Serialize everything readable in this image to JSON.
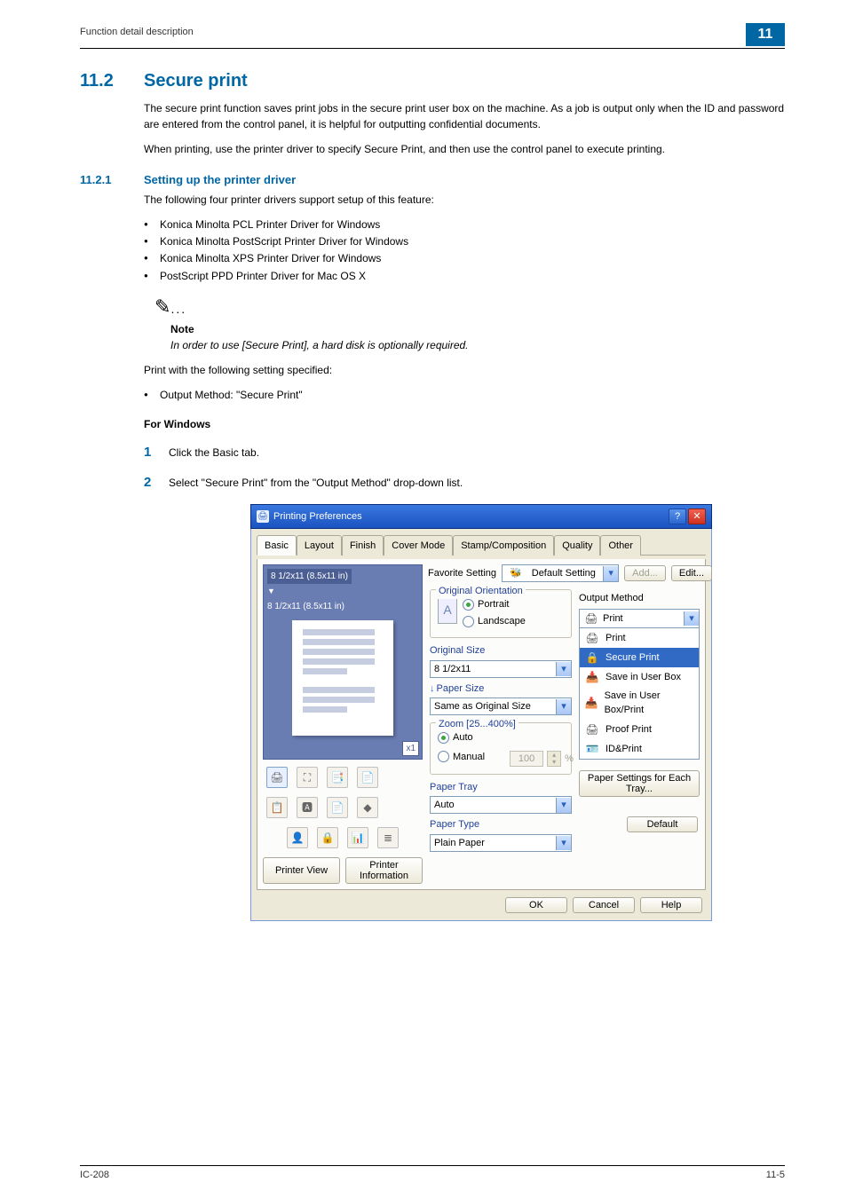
{
  "header": {
    "left": "Function detail description",
    "badge": "11"
  },
  "section": {
    "num": "11.2",
    "title": "Secure print",
    "para1": "The secure print function saves print jobs in the secure print user box on the machine. As a job is output only when the ID and password are entered from the control panel, it is helpful for outputting confidential documents.",
    "para2": "When printing, use the printer driver to specify Secure Print, and then use the control panel to execute printing."
  },
  "subsection": {
    "num": "11.2.1",
    "title": "Setting up the printer driver",
    "intro": "The following four printer drivers support setup of this feature:",
    "drivers": [
      "Konica Minolta PCL Printer Driver for Windows",
      "Konica Minolta PostScript Printer Driver for Windows",
      "Konica Minolta XPS Printer Driver for Windows",
      "PostScript PPD Printer Driver for Mac OS X"
    ],
    "note_label": "Note",
    "note_text": "In order to use [Secure Print], a hard disk is optionally required.",
    "print_with": "Print with the following setting specified:",
    "setting_item": "Output Method: \"Secure Print\"",
    "for_windows": "For Windows",
    "step1": "Click the Basic tab.",
    "step2": "Select \"Secure Print\" from the \"Output Method\" drop-down list."
  },
  "dialog": {
    "title": "Printing Preferences",
    "tabs": [
      "Basic",
      "Layout",
      "Finish",
      "Cover Mode",
      "Stamp/Composition",
      "Quality",
      "Other"
    ],
    "preview": {
      "size1": "8 1/2x11 (8.5x11 in)",
      "size2": "8 1/2x11 (8.5x11 in)",
      "badge": "x1"
    },
    "printer_view": "Printer View",
    "printer_info": "Printer Information",
    "fav_label": "Favorite Setting",
    "fav_value": "Default Setting",
    "add": "Add...",
    "edit": "Edit...",
    "orientation": {
      "title": "Original Orientation",
      "portrait": "Portrait",
      "landscape": "Landscape"
    },
    "original_size_label": "Original Size",
    "original_size_value": "8 1/2x11",
    "paper_size_label": "Paper Size",
    "paper_size_value": "Same as Original Size",
    "zoom": {
      "title": "Zoom [25...400%]",
      "auto": "Auto",
      "manual": "Manual",
      "value": "100",
      "pct": "%"
    },
    "paper_tray_label": "Paper Tray",
    "paper_tray_value": "Auto",
    "paper_type_label": "Paper Type",
    "paper_type_value": "Plain Paper",
    "output_method_label": "Output Method",
    "output_method_value": "Print",
    "output_options": [
      "Print",
      "Secure Print",
      "Save in User Box",
      "Save in User Box/Print",
      "Proof Print",
      "ID&Print"
    ],
    "pst": "Paper Settings for Each Tray...",
    "default": "Default",
    "ok": "OK",
    "cancel": "Cancel",
    "help": "Help"
  },
  "footer": {
    "left": "IC-208",
    "right": "11-5"
  }
}
